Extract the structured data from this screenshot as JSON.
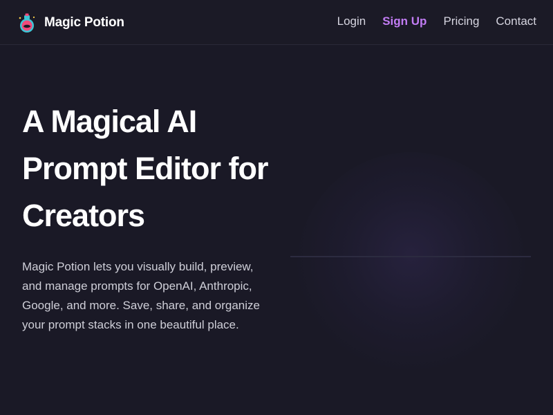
{
  "brand": {
    "name": "Magic Potion",
    "logo_icon": "potion-bottle-icon"
  },
  "nav": {
    "items": [
      {
        "label": "Login",
        "active": false
      },
      {
        "label": "Sign Up",
        "active": true
      },
      {
        "label": "Pricing",
        "active": false
      },
      {
        "label": "Contact",
        "active": false
      }
    ]
  },
  "hero": {
    "title": "A Magical AI Prompt Editor for Creators",
    "description": "Magic Potion lets you visually build, preview, and manage prompts for OpenAI, Anthropic, Google, and more. Save, share, and organize your prompt stacks in one beautiful place."
  },
  "colors": {
    "background": "#1a1926",
    "accent": "#c27cf4",
    "text_primary": "#ffffff",
    "text_secondary": "#cfcfd8"
  }
}
